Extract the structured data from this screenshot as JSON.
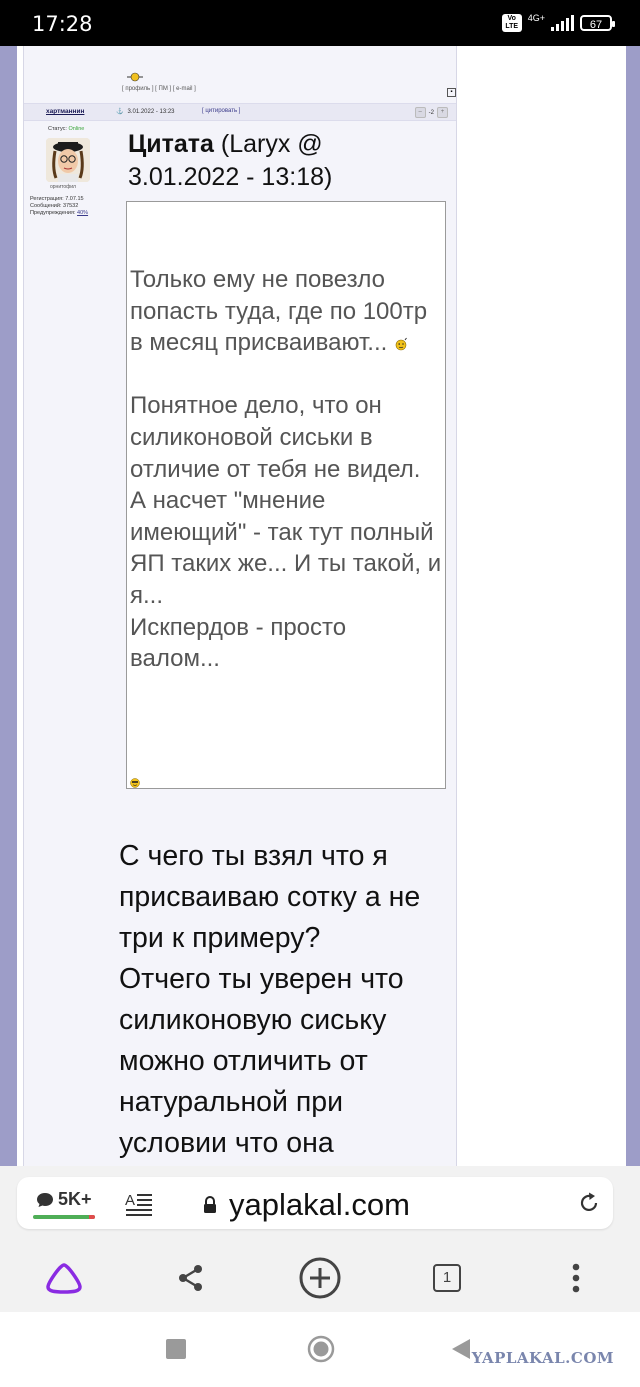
{
  "status_bar": {
    "time": "17:28",
    "volte": "Vo LTE",
    "network": "4G+",
    "battery": "67"
  },
  "prev_post": {
    "links": "[ профиль ] [ ПМ ] [ e-mail ]"
  },
  "post": {
    "username": "хартманнин",
    "date": "3.01.2022 - 13:23",
    "quote_link": "[ цитировать ]",
    "rating": "-2",
    "status_label": "Статус:",
    "status_value": "Online",
    "avatar_caption": "орнитофил",
    "registration": "Регистрация: 7.07.15",
    "messages": "Сообщений: 37532",
    "warnings_label": "Предупреждения:",
    "warnings_value": "40%",
    "quote_word": "Цитата",
    "quote_source": " (Laryx @ 3.01.2022 - 13:18)",
    "quote_line1": "Только ему не повезло попасть туда, где по 100тр в месяц присваивают... ",
    "quote_body": "Понятное дело, что он силиконовой сиськи в отличие от тебя не видел.\nА насчет \"мнение имеющий\" - так тут полный ЯП таких же... И ты такой, и я...\nИскпердов - просто валом...",
    "reply": "С чего ты взял что я присваиваю сотку а не три к примеру?\nОтчего ты уверен что силиконовую сиську можно отличить от натуральной при условии что она"
  },
  "browser": {
    "comments_count": "5K+",
    "url": "yaplakal.com",
    "tabs_count": "1"
  },
  "watermark": "YAPLAKAL.COM",
  "colors": {
    "page_bg": "#9d9dc8",
    "online": "#3aa53a",
    "alice_purple": "#8a2be2"
  }
}
